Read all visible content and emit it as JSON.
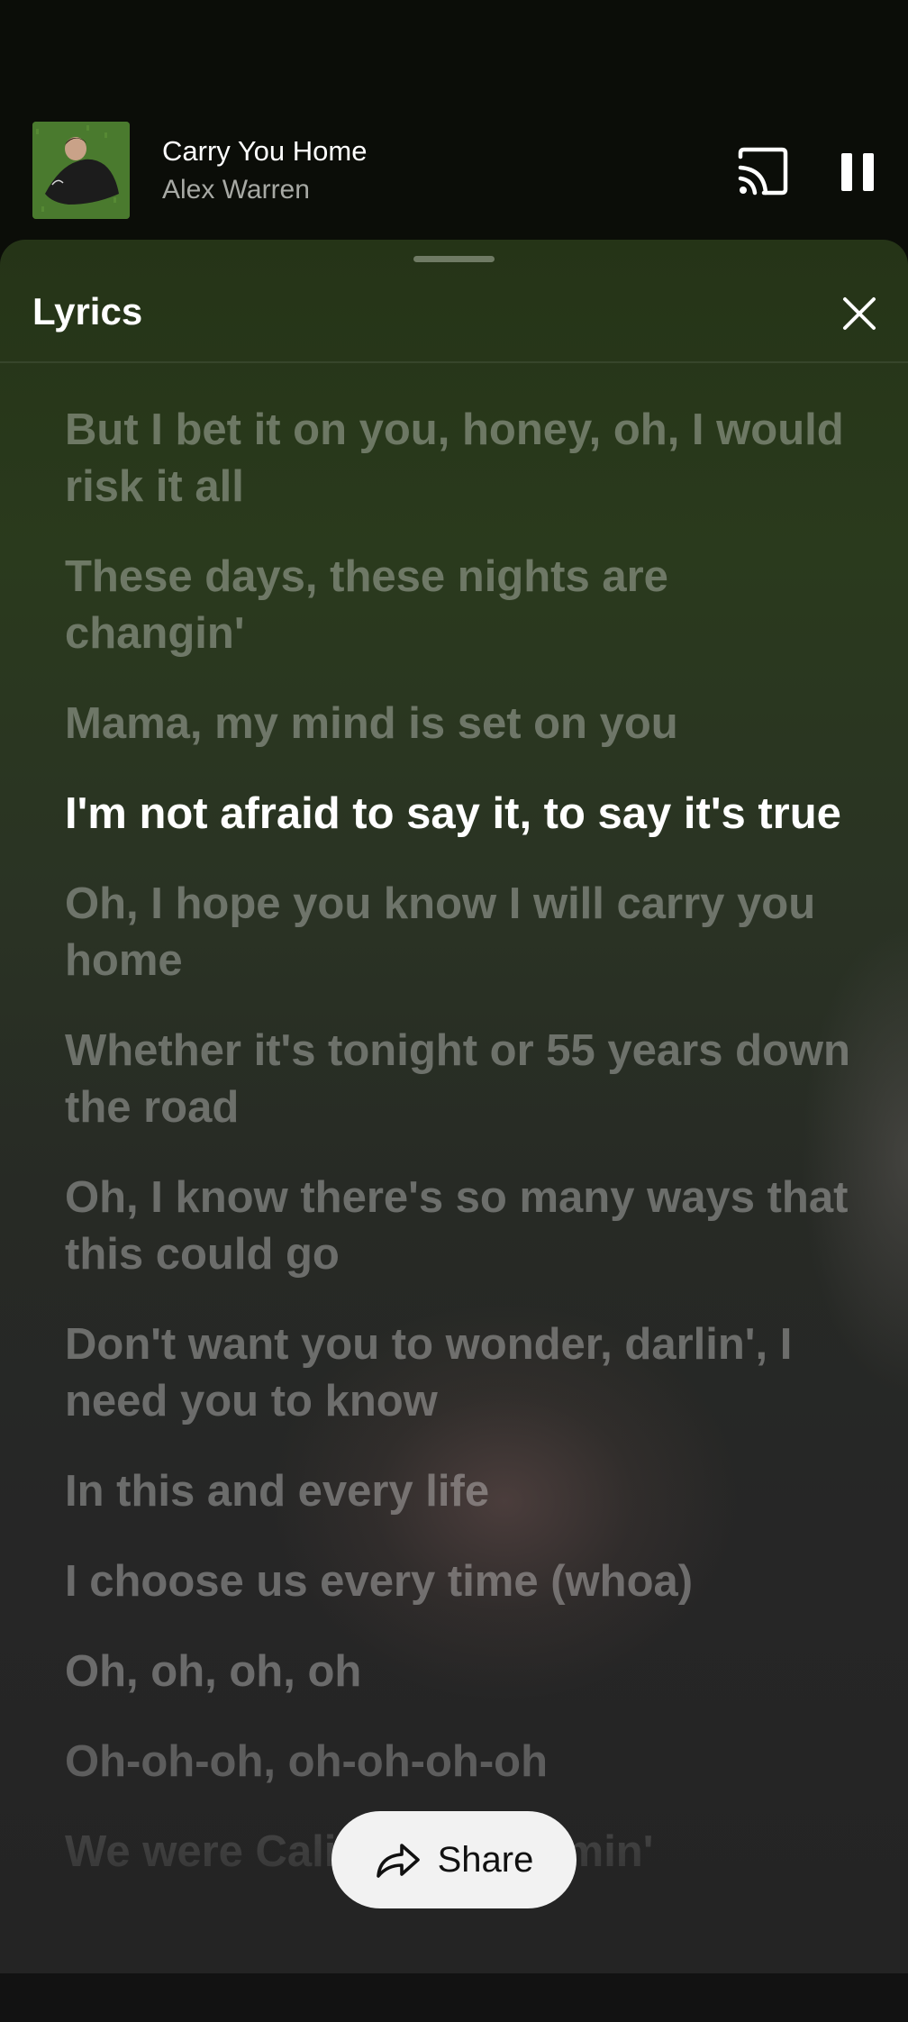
{
  "now_playing": {
    "title": "Carry You Home",
    "artist": "Alex Warren",
    "cast_icon": "cast-icon",
    "pause_icon": "pause-icon"
  },
  "lyrics_sheet": {
    "title": "Lyrics",
    "close_icon": "close-icon",
    "lines": [
      "But I bet it on you, honey, oh, I would risk it all",
      "These days, these nights are changin'",
      "Mama, my mind is set on you",
      "I'm not afraid to say it, to say it's true",
      "Oh, I hope you know I will carry you home",
      "Whether it's tonight or 55 years down the road",
      "Oh, I know there's so many ways that this could go",
      "Don't want you to wonder, darlin', I need you to know",
      "In this and every life",
      "I choose us every time (whoa)",
      "Oh, oh, oh, oh",
      "Oh-oh-oh, oh-oh-oh-oh",
      "We were California dreamin'"
    ],
    "active_line_index": 3
  },
  "share": {
    "label": "Share",
    "icon": "share-icon"
  },
  "colors": {
    "background": "#0b0d08",
    "sheet_top": "#253417",
    "sheet_bottom": "#242424",
    "active_lyric": "#ffffff",
    "share_button": "#f2f2f2"
  }
}
